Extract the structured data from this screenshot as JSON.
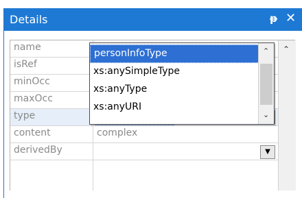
{
  "window": {
    "title": "Details",
    "pin_glyph": "ᵽ",
    "close_glyph": "✕"
  },
  "properties": [
    {
      "name": "name",
      "value": ""
    },
    {
      "name": "isRef",
      "value": ""
    },
    {
      "name": "minOcc",
      "value": ""
    },
    {
      "name": "maxOcc",
      "value": ""
    },
    {
      "name": "type",
      "value": "personInfoType"
    },
    {
      "name": "content",
      "value": "complex"
    },
    {
      "name": "derivedBy",
      "value": ""
    }
  ],
  "dropdown": {
    "options": [
      "personInfoType",
      "xs:anySimpleType",
      "xs:anyType",
      "xs:anyURI"
    ],
    "selected": "personInfoType"
  },
  "icons": {
    "up": "▲",
    "down": "▼",
    "scroll_up": "⌃",
    "scroll_down": "⌄"
  },
  "colors": {
    "titlebar": "#1e79d4",
    "selection": "#2d6fd3",
    "label_text": "#8a8a8a"
  }
}
